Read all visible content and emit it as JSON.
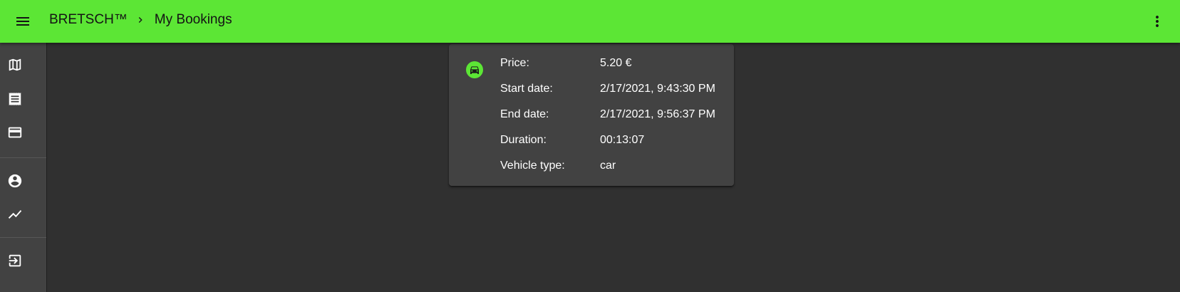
{
  "colors": {
    "accent": "#5ce635",
    "background": "#303030",
    "surface": "#424242",
    "text": "#ffffff",
    "appbar_text": "#141414"
  },
  "appbar": {
    "menu_icon": "menu-icon",
    "brand": "BRETSCH™",
    "separator_icon": "chevron-right-icon",
    "page_title": "My Bookings",
    "more_icon": "more-vertical-icon"
  },
  "sidebar": {
    "items": [
      {
        "icon": "map-icon"
      },
      {
        "icon": "receipt-icon"
      },
      {
        "icon": "credit-card-icon"
      },
      {
        "icon": "account-circle-icon"
      },
      {
        "icon": "trending-icon"
      },
      {
        "icon": "logout-icon"
      }
    ]
  },
  "booking": {
    "vehicle_icon": "car-icon",
    "price": {
      "label": "Price:",
      "value": "5.20 €"
    },
    "start_date": {
      "label": "Start date:",
      "value": "2/17/2021, 9:43:30 PM"
    },
    "end_date": {
      "label": "End date:",
      "value": "2/17/2021, 9:56:37 PM"
    },
    "duration": {
      "label": "Duration:",
      "value": "00:13:07"
    },
    "vehicle_type": {
      "label": "Vehicle type:",
      "value": "car"
    }
  }
}
